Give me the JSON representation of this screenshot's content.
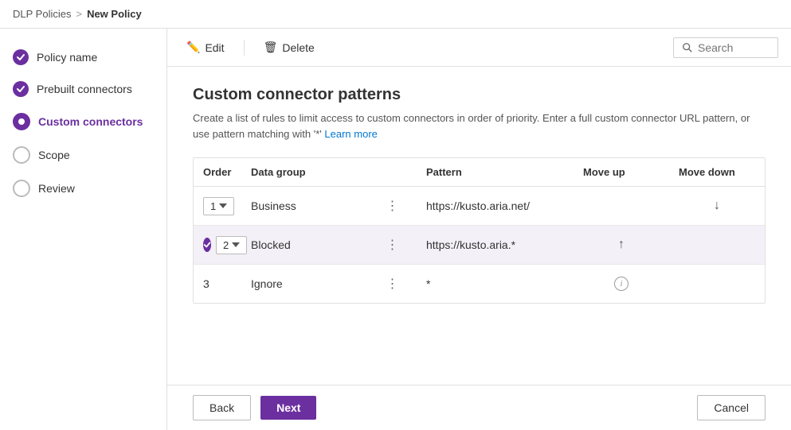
{
  "topbar": {
    "breadcrumb_link": "DLP Policies",
    "breadcrumb_sep": ">",
    "breadcrumb_current": "New Policy"
  },
  "sidebar": {
    "items": [
      {
        "id": "policy-name",
        "label": "Policy name",
        "state": "completed"
      },
      {
        "id": "prebuilt-connectors",
        "label": "Prebuilt connectors",
        "state": "completed"
      },
      {
        "id": "custom-connectors",
        "label": "Custom connectors",
        "state": "active"
      },
      {
        "id": "scope",
        "label": "Scope",
        "state": "empty"
      },
      {
        "id": "review",
        "label": "Review",
        "state": "empty"
      }
    ]
  },
  "toolbar": {
    "edit_label": "Edit",
    "delete_label": "Delete",
    "search_placeholder": "Search"
  },
  "page": {
    "title": "Custom connector patterns",
    "description": "Create a list of rules to limit access to custom connectors in order of priority. Enter a full custom connector URL pattern, or use pattern matching with '*'",
    "learn_more": "Learn more"
  },
  "table": {
    "headers": [
      "Order",
      "Data group",
      "",
      "Pattern",
      "Move up",
      "Move down"
    ],
    "rows": [
      {
        "order": "1",
        "data_group": "Business",
        "pattern": "https://kusto.aria.net/",
        "move_up": false,
        "move_down": true,
        "highlighted": false
      },
      {
        "order": "2",
        "data_group": "Blocked",
        "pattern": "https://kusto.aria.*",
        "move_up": true,
        "move_down": false,
        "highlighted": true,
        "completed": true
      },
      {
        "order": "3",
        "data_group": "Ignore",
        "pattern": "*",
        "move_up": false,
        "move_down": false,
        "highlighted": false,
        "info": true
      }
    ]
  },
  "footer": {
    "back_label": "Back",
    "next_label": "Next",
    "cancel_label": "Cancel"
  }
}
